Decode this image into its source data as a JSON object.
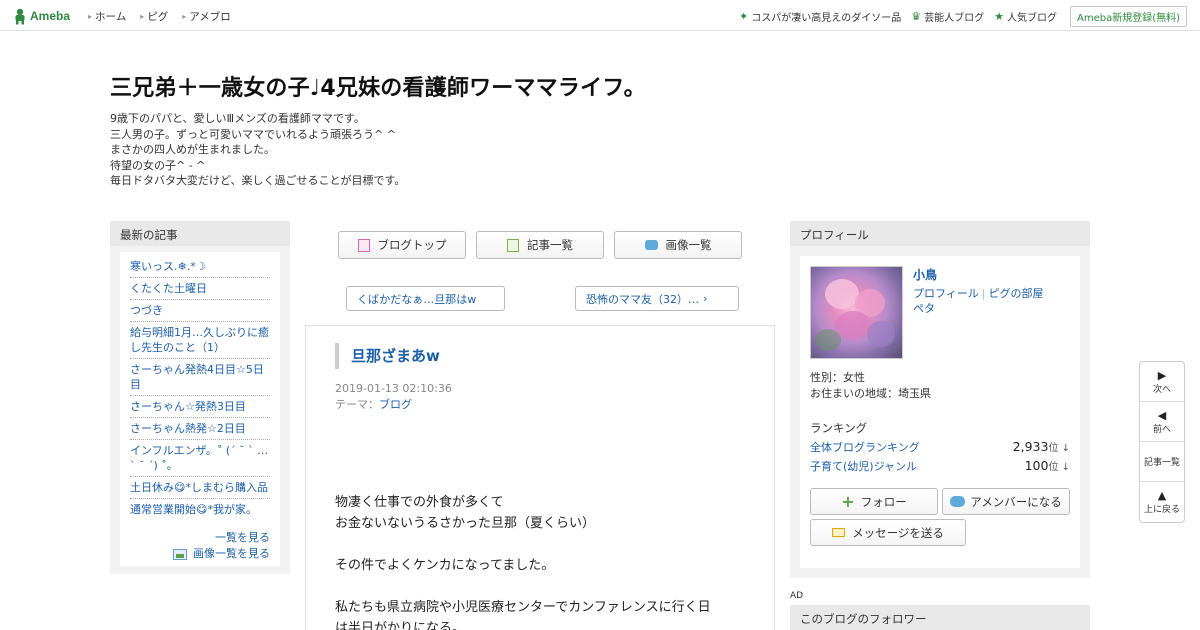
{
  "topbar": {
    "logo": "Ameba",
    "nav": [
      "ホーム",
      "ピグ",
      "アメブロ"
    ],
    "right_links": [
      {
        "icon": "sparkle-icon",
        "label": "コスパが凄い高見えのダイソー品"
      },
      {
        "icon": "crown-icon",
        "label": "芸能人ブログ"
      },
      {
        "icon": "star-icon",
        "label": "人気ブログ"
      }
    ],
    "register": "Ameba新規登録(無料)"
  },
  "header": {
    "title": "三兄弟＋一歳女の子♩4兄妹の看護師ワーママライフ。",
    "description": [
      "9歳下のパパと、愛しいⅢメンズの看護師ママです。",
      "三人男の子。ずっと可愛いママでいれるよう頑張ろう^ ^",
      "まさかの四人めが生まれました。",
      "待望の女の子^ - ^",
      "毎日ドタバタ大変だけど、楽しく過ごせることが目標です。"
    ]
  },
  "left": {
    "heading": "最新の記事",
    "articles": [
      "寒いっス.❄︎.*☽",
      "くたくた土曜日",
      "つづき",
      "給与明細1月…久しぶりに癒し先生のこと（1）",
      "さーちゃん発熱4日目☆5日目",
      "さーちゃん☆発熱3日目",
      "さーちゃん熱発☆2日目",
      "インフルエンザ。˚ (ˊ ˘ ˋ …ˋ ˘ ˊ) ˚。",
      "土日休み😋*しまむら購入品",
      "通常営業開始😋*我が家。"
    ],
    "see_all": "一覧を見る",
    "see_images": "画像一覧を見る"
  },
  "center": {
    "buttons": [
      "ブログトップ",
      "記事一覧",
      "画像一覧"
    ],
    "prev": "くばかだなぁ…旦那はw",
    "next": "恐怖のママ友（32）…",
    "article": {
      "title": "旦那ざまあw",
      "date": "2019-01-13 02:10:36",
      "theme_label": "テーマ：",
      "theme": "ブログ",
      "paragraphs": [
        [
          "物凄く仕事での外食が多くて",
          "お金ないないうるさかった旦那（夏くらい）"
        ],
        [
          "その件でよくケンカになってました。"
        ],
        [
          "私たちも県立病院や小児医療センターでカンファレンスに行く日",
          "は半日がかりになる。"
        ]
      ]
    }
  },
  "right": {
    "heading": "プロフィール",
    "name": "小鳥",
    "links": [
      "プロフィール",
      "ピグの部屋",
      "ペタ"
    ],
    "gender": "性別：女性",
    "region": "お住まいの地域：埼玉県",
    "ranking_heading": "ランキング",
    "rankings": [
      {
        "label": "全体ブログランキング",
        "value": "2,933",
        "unit": "位 ↓"
      },
      {
        "label": "子育て(幼児)ジャンル",
        "value": "100",
        "unit": "位 ↓"
      }
    ],
    "follow": "フォロー",
    "amember": "アメンバーになる",
    "message": "メッセージを送る",
    "ad": "AD",
    "followers_heading": "このブログのフォロワー"
  },
  "float_nav": [
    "次へ",
    "前へ",
    "記事一覧",
    "上に戻る"
  ]
}
